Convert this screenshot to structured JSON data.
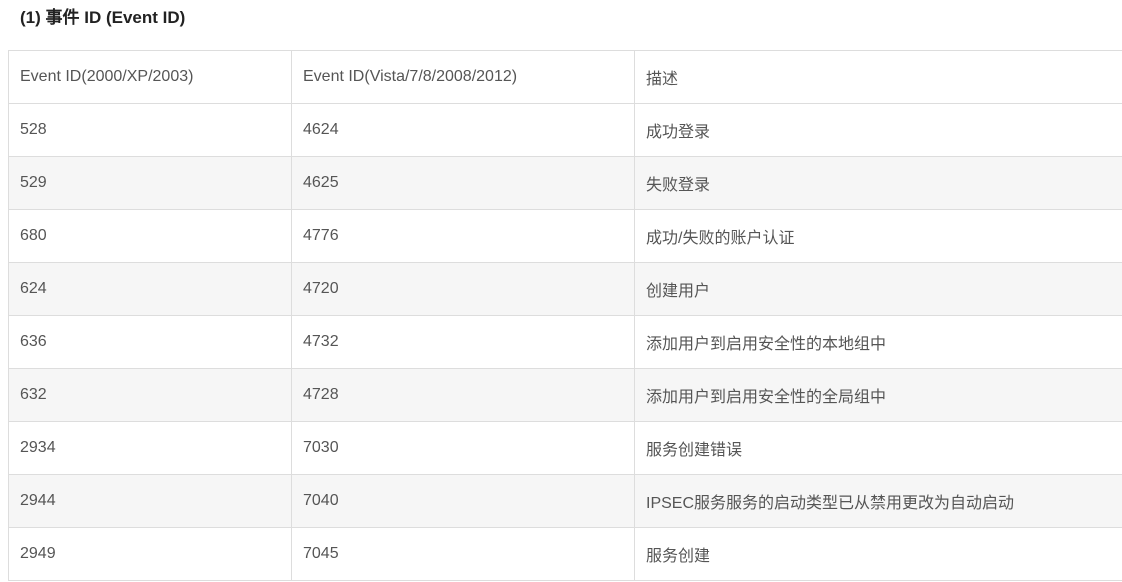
{
  "heading": "(1) 事件 ID (Event ID)",
  "table": {
    "headers": [
      "Event ID(2000/XP/2003)",
      "Event ID(Vista/7/8/2008/2012)",
      "描述"
    ],
    "rows": [
      [
        "528",
        "4624",
        "成功登录"
      ],
      [
        "529",
        "4625",
        "失败登录"
      ],
      [
        "680",
        "4776",
        "成功/失败的账户认证"
      ],
      [
        "624",
        "4720",
        "创建用户"
      ],
      [
        "636",
        "4732",
        "添加用户到启用安全性的本地组中"
      ],
      [
        "632",
        "4728",
        "添加用户到启用安全性的全局组中"
      ],
      [
        "2934",
        "7030",
        "服务创建错误"
      ],
      [
        "2944",
        "7040",
        "IPSEC服务服务的启动类型已从禁用更改为自动启动"
      ],
      [
        "2949",
        "7045",
        "服务创建"
      ]
    ]
  }
}
